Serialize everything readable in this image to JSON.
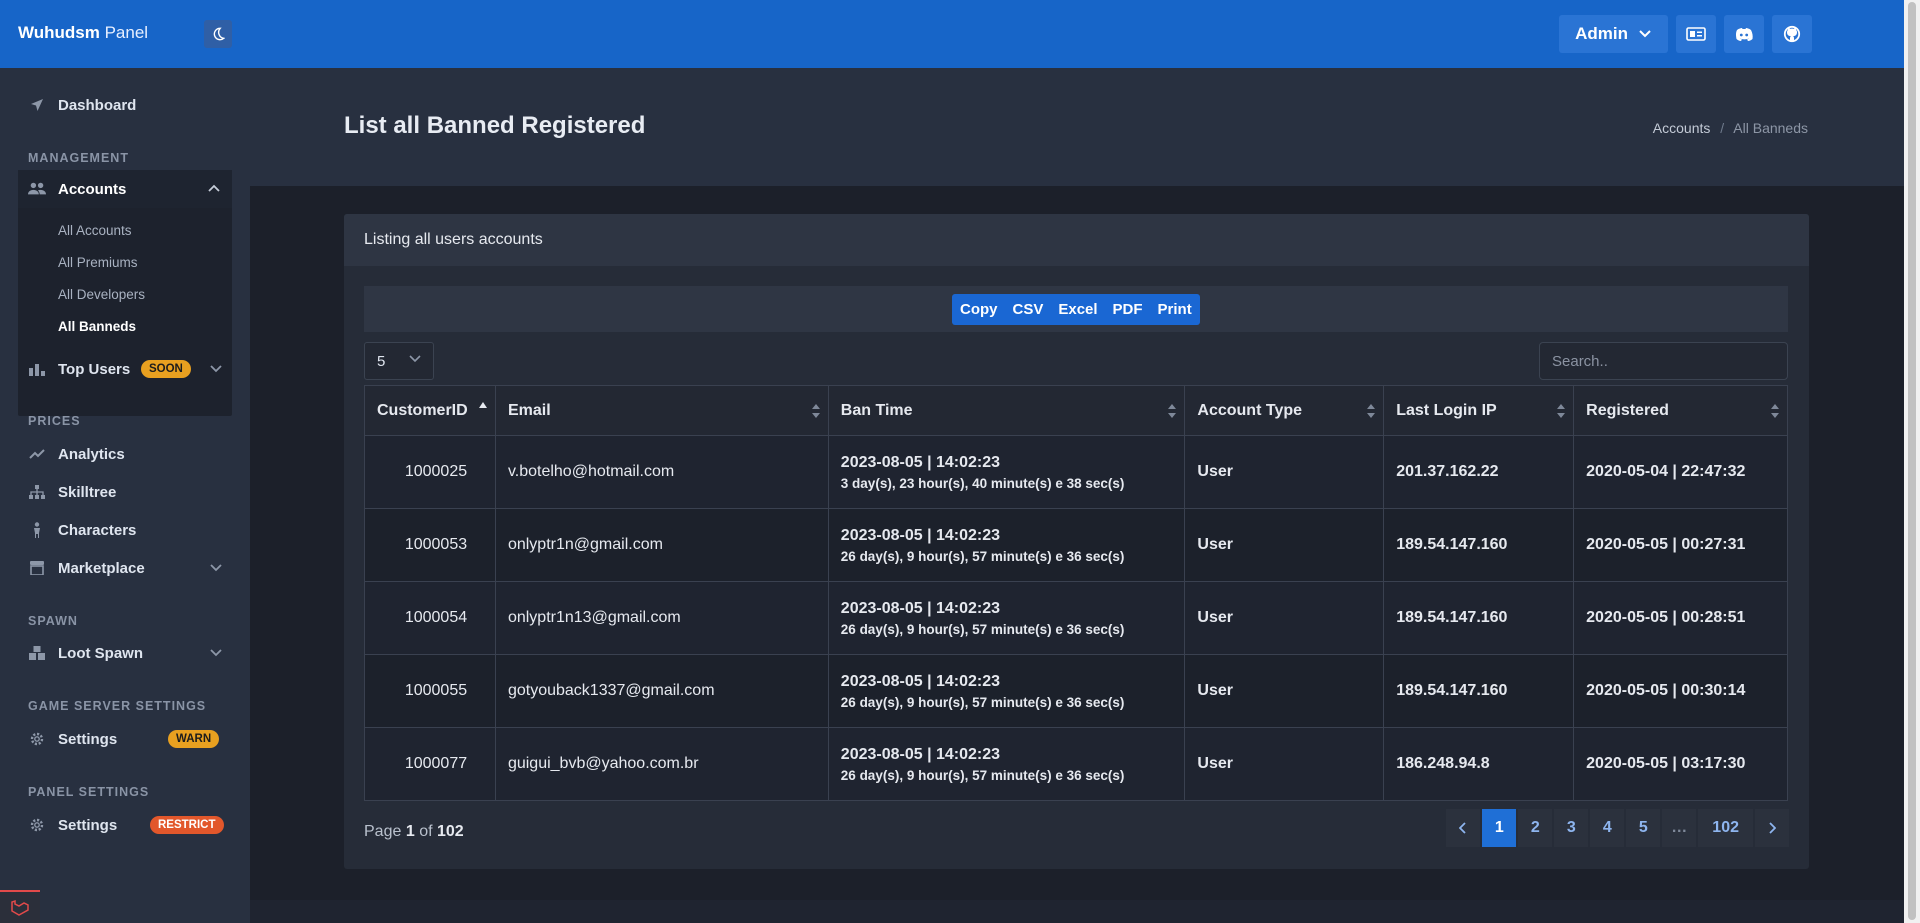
{
  "brand": {
    "name": "Wuhudsm",
    "suffix": "Panel"
  },
  "header": {
    "admin_label": "Admin",
    "icons": [
      "moon-icon",
      "id-card-icon",
      "discord-icon",
      "github-icon"
    ]
  },
  "sidebar": {
    "dashboard": "Dashboard",
    "sections": {
      "management": "MANAGEMENT",
      "prices": "PRICES",
      "spawn": "SPAWN",
      "game_server": "GAME SERVER SETTINGS",
      "panel": "PANEL SETTINGS"
    },
    "accounts": {
      "label": "Accounts",
      "items": [
        "All Accounts",
        "All Premiums",
        "All Developers",
        "All Banneds"
      ]
    },
    "top_users": {
      "label": "Top Users",
      "badge": "SOON"
    },
    "analytics": "Analytics",
    "skilltree": "Skilltree",
    "characters": "Characters",
    "marketplace": "Marketplace",
    "loot_spawn": "Loot Spawn",
    "game_settings": {
      "label": "Settings",
      "badge": "WARN"
    },
    "panel_settings": {
      "label": "Settings",
      "badge": "RESTRICT"
    }
  },
  "page": {
    "title": "List all Banned Registered",
    "breadcrumb": {
      "parent": "Accounts",
      "separator": "/",
      "current": "All Banneds"
    }
  },
  "card": {
    "title": "Listing all users accounts",
    "export_buttons": [
      "Copy",
      "CSV",
      "Excel",
      "PDF",
      "Print"
    ],
    "page_length": "5",
    "search_placeholder": "Search.."
  },
  "table": {
    "headers": [
      "CustomerID",
      "Email",
      "Ban Time",
      "Account Type",
      "Last Login IP",
      "Registered"
    ],
    "rows": [
      {
        "id": "1000025",
        "email": "v.botelho@hotmail.com",
        "ban_date": "2023-08-05 | 14:02:23",
        "ban_duration": "3 day(s), 23 hour(s), 40 minute(s) e 38 sec(s)",
        "type": "User",
        "ip": "201.37.162.22",
        "registered": "2020-05-04 | 22:47:32"
      },
      {
        "id": "1000053",
        "email": "onlyptr1n@gmail.com",
        "ban_date": "2023-08-05 | 14:02:23",
        "ban_duration": "26 day(s), 9 hour(s), 57 minute(s) e 36 sec(s)",
        "type": "User",
        "ip": "189.54.147.160",
        "registered": "2020-05-05 | 00:27:31"
      },
      {
        "id": "1000054",
        "email": "onlyptr1n13@gmail.com",
        "ban_date": "2023-08-05 | 14:02:23",
        "ban_duration": "26 day(s), 9 hour(s), 57 minute(s) e 36 sec(s)",
        "type": "User",
        "ip": "189.54.147.160",
        "registered": "2020-05-05 | 00:28:51"
      },
      {
        "id": "1000055",
        "email": "gotyouback1337@gmail.com",
        "ban_date": "2023-08-05 | 14:02:23",
        "ban_duration": "26 day(s), 9 hour(s), 57 minute(s) e 36 sec(s)",
        "type": "User",
        "ip": "189.54.147.160",
        "registered": "2020-05-05 | 00:30:14"
      },
      {
        "id": "1000077",
        "email": "guigui_bvb@yahoo.com.br",
        "ban_date": "2023-08-05 | 14:02:23",
        "ban_duration": "26 day(s), 9 hour(s), 57 minute(s) e 36 sec(s)",
        "type": "User",
        "ip": "186.248.94.8",
        "registered": "2020-05-05 | 03:17:30"
      }
    ]
  },
  "pagination": {
    "info_prefix": "Page",
    "current": "1",
    "info_of": "of",
    "total": "102",
    "pages": [
      "1",
      "2",
      "3",
      "4",
      "5",
      "…",
      "102"
    ]
  },
  "colors": {
    "header_blue": "#1765c8",
    "sidebar_bg": "#283040",
    "content_bg": "#1c202a",
    "accent": "#1f6fd6",
    "badge_yellow": "#e8a020",
    "badge_orange": "#e2572b"
  }
}
